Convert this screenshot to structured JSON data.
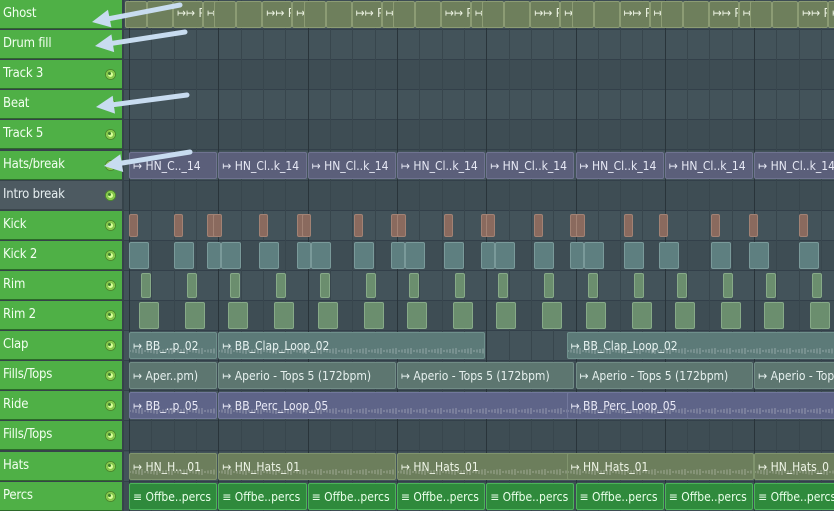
{
  "tracks": [
    {
      "name": "Ghost",
      "style": "green"
    },
    {
      "name": "Drum fill",
      "style": "green"
    },
    {
      "name": "Track 3",
      "style": "green"
    },
    {
      "name": "Beat",
      "style": "green"
    },
    {
      "name": "Track 5",
      "style": "green"
    },
    {
      "name": "Hats/break",
      "style": "green"
    },
    {
      "name": "Intro break",
      "style": "dark"
    },
    {
      "name": "Kick",
      "style": "green"
    },
    {
      "name": "Kick 2",
      "style": "green"
    },
    {
      "name": "Rim",
      "style": "green"
    },
    {
      "name": "Rim 2",
      "style": "green"
    },
    {
      "name": "Clap",
      "style": "green"
    },
    {
      "name": "Fills/Tops",
      "style": "green"
    },
    {
      "name": "Ride",
      "style": "green"
    },
    {
      "name": "Fills/Tops",
      "style": "green"
    },
    {
      "name": "Hats",
      "style": "green"
    },
    {
      "name": "Percs",
      "style": "green"
    }
  ],
  "clip_labels": {
    "ghost_p": "P..",
    "ghost_pp": "P",
    "hn_clk_first": "HN_C.._14",
    "hn_clk": "HN_Cl..k_14",
    "clap_short": "BB_..p_02",
    "clap_long": "BB_Clap_Loop_02",
    "fills_short": "Aper..pm)",
    "fills_long": "Aperio - Tops 5 (172bpm)",
    "fills_cut": "Aperio - Top",
    "ride_short": "BB_..p_05",
    "ride_long": "BB_Perc_Loop_05",
    "hats_short": "HN_H.._01",
    "hats_long": "HN_Hats_01",
    "hats_cut": "HN_Hats_0",
    "percs": "Offbe..percs"
  },
  "colors": {
    "track_green": "#4fb046",
    "track_dark": "#4d5a61",
    "annotation_arrow": "#c8dcf0"
  }
}
